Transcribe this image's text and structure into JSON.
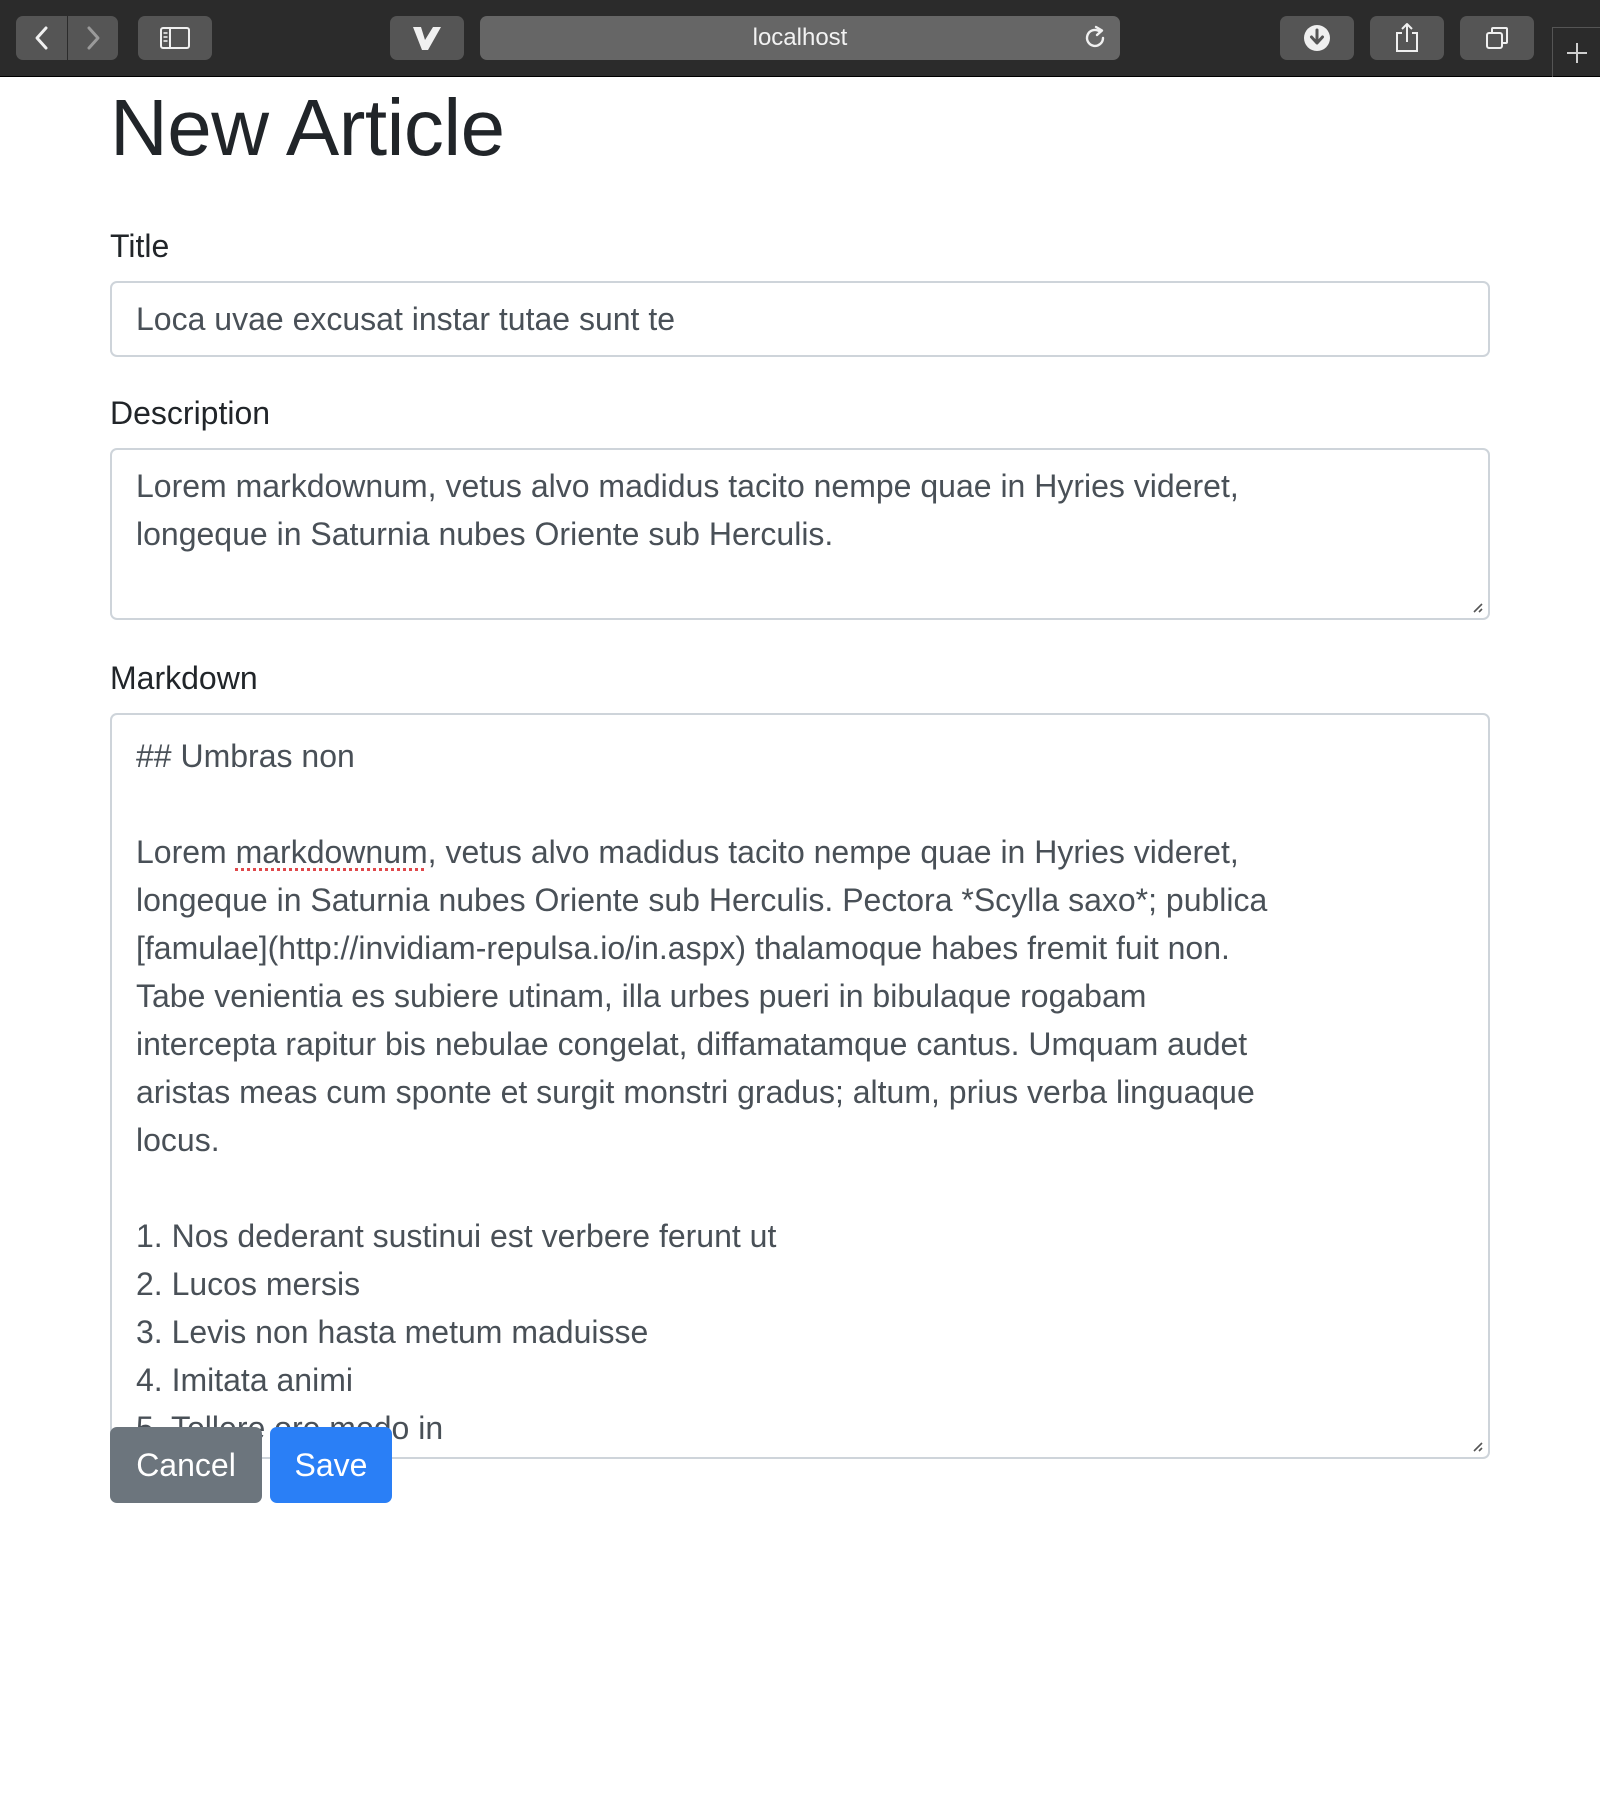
{
  "browser": {
    "url": "localhost",
    "icons": {
      "back": "chevron-left-icon",
      "forward": "chevron-right-icon",
      "sidebar": "sidebar-icon",
      "extension": "v-logo-icon",
      "reload": "reload-icon",
      "download": "download-icon",
      "share": "share-icon",
      "tabs": "tabs-overview-icon",
      "new_tab": "plus-icon"
    }
  },
  "page": {
    "heading": "New Article"
  },
  "form": {
    "title": {
      "label": "Title",
      "value": "Loca uvae excusat instar tutae sunt te"
    },
    "description": {
      "label": "Description",
      "value": "Lorem markdownum, vetus alvo madidus tacito nempe quae in Hyries videret,\nlongeque in Saturnia nubes Oriente sub Herculis."
    },
    "markdown": {
      "label": "Markdown",
      "heading_line": "## Umbras non",
      "para_before_flagged": "Lorem ",
      "flagged_word": "markdownum",
      "para_after_flagged": ", vetus alvo madidus tacito nempe quae in Hyries videret,\nlongeque in Saturnia nubes Oriente sub Herculis. Pectora *Scylla saxo*; publica\n[famulae](http://invidiam-repulsa.io/in.aspx) thalamoque habes fremit fuit non.\nTabe venientia es subiere utinam, illa urbes pueri in bibulaque rogabam\nintercepta rapitur bis nebulae congelat, diffamatamque cantus. Umquam audet\naristas meas cum sponte et surgit monstri gradus; altum, prius verba linguaque\nlocus.",
      "list": [
        "1. Nos dederant sustinui est verbere ferunt ut",
        "2. Lucos mersis",
        "3. Levis non hasta metum maduisse",
        "4. Imitata animi",
        "5. Tollere ore modo in"
      ]
    }
  },
  "buttons": {
    "cancel": "Cancel",
    "save": "Save"
  },
  "colors": {
    "save": "#2a7ff6",
    "cancel": "#6c757d",
    "toolbar": "#2b2b2b"
  }
}
